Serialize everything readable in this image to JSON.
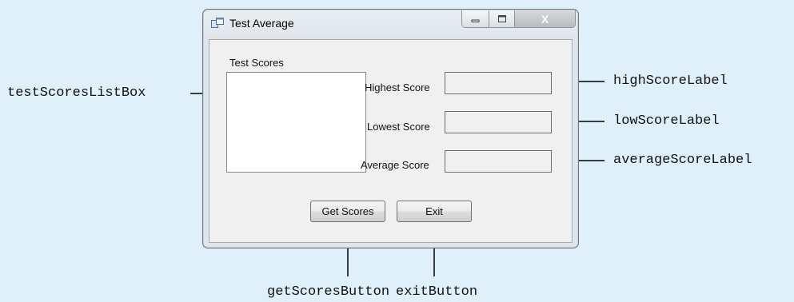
{
  "window": {
    "title": "Test Average",
    "icon": "app-form-icon",
    "controls": {
      "minimize": "minimize-icon",
      "maximize": "maximize-icon",
      "close": "close-icon",
      "close_glyph": "X"
    }
  },
  "form": {
    "test_scores_label": "Test Scores",
    "highest_label": "Highest Score",
    "lowest_label": "Lowest Score",
    "average_label": "Average Score",
    "get_scores_button": "Get Scores",
    "exit_button": "Exit"
  },
  "callouts": {
    "list_box": "testScoresListBox",
    "high_label": "highScoreLabel",
    "low_label": "lowScoreLabel",
    "average_label": "averageScoreLabel",
    "get_scores_button": "getScoresButton",
    "exit_button": "exitButton"
  },
  "colors": {
    "background": "#dff0fa",
    "window_frame": "#dfe5ea",
    "client_area": "#f0f0f0"
  }
}
